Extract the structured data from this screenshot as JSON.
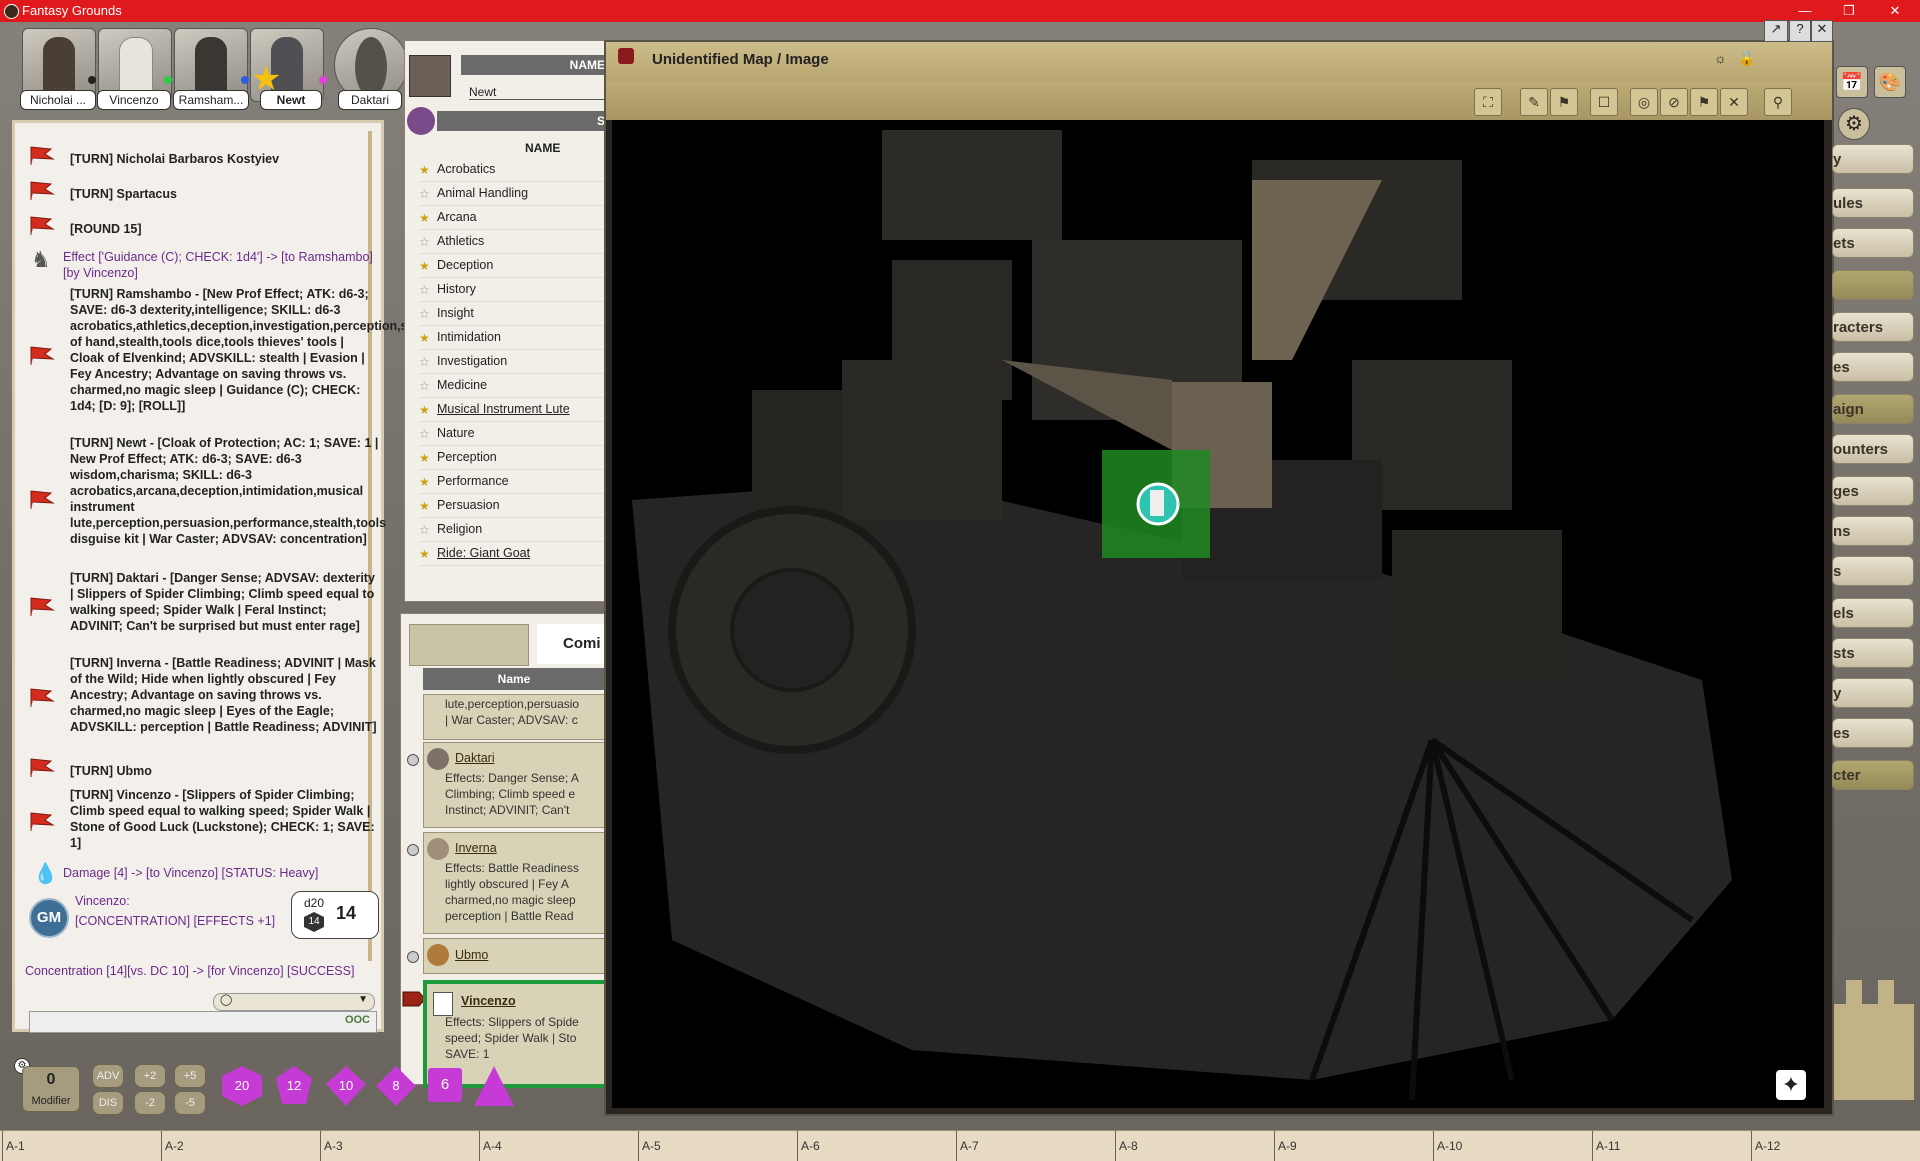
{
  "app": {
    "title": "Fantasy Grounds"
  },
  "portraits": [
    {
      "name": "Nicholai ...",
      "dot": "#222222"
    },
    {
      "name": "Vincenzo",
      "dot": "#2ecc40"
    },
    {
      "name": "Ramsham...",
      "dot": "#2b5ee0"
    },
    {
      "name": "Newt",
      "dot": "#e040e0"
    },
    {
      "name": "Daktari",
      "dot": ""
    }
  ],
  "chat": {
    "lines": [
      {
        "text": "[TURN] Nicholai Barbaros Kostyiev"
      },
      {
        "text": "[TURN] Spartacus"
      },
      {
        "text": "[ROUND 15]"
      },
      {
        "text": "Effect ['Guidance (C); CHECK: 1d4'] -> [to Ramshambo] [by Vincenzo]"
      },
      {
        "text": "[TURN] Ramshambo - [New Prof Effect; ATK: d6-3; SAVE: d6-3 dexterity,intelligence; SKILL: d6-3 acrobatics,athletics,deception,investigation,perception,sleight of hand,stealth,tools dice,tools thieves' tools | Cloak of Elvenkind; ADVSKILL: stealth | Evasion | Fey Ancestry; Advantage on saving throws vs. charmed,no magic sleep | Guidance (C); CHECK: 1d4; [D: 9]; [ROLL]]"
      },
      {
        "text": "[TURN] Newt - [Cloak of Protection; AC: 1; SAVE: 1 | New Prof Effect; ATK: d6-3; SAVE: d6-3 wisdom,charisma; SKILL: d6-3 acrobatics,arcana,deception,intimidation,musical instrument lute,perception,persuasion,performance,stealth,tools disguise kit | War Caster; ADVSAV: concentration]"
      },
      {
        "text": "[TURN] Daktari - [Danger Sense; ADVSAV: dexterity | Slippers of Spider Climbing; Climb speed equal to walking speed; Spider Walk | Feral Instinct; ADVINIT; Can't be surprised but must enter rage]"
      },
      {
        "text": "[TURN] Inverna - [Battle Readiness; ADVINIT | Mask of the Wild; Hide when lightly obscured | Fey Ancestry; Advantage on saving throws vs. charmed,no magic sleep | Eyes of the Eagle; ADVSKILL: perception | Battle Readiness; ADVINIT]"
      },
      {
        "text": "[TURN] Ubmo"
      },
      {
        "text": "[TURN] Vincenzo - [Slippers of Spider Climbing; Climb speed equal to walking speed; Spider Walk | Stone of Good Luck (Luckstone); CHECK: 1; SAVE: 1]"
      },
      {
        "text": "Damage [4] -> [to Vincenzo] [STATUS: Heavy]"
      },
      {
        "text": "Vincenzo:"
      },
      {
        "text": "[CONCENTRATION] [EFFECTS +1]"
      },
      {
        "text": "Concentration [14][vs. DC 10] -> [for Vincenzo] [SUCCESS]"
      }
    ],
    "gm_badge": "GM",
    "dice_result": {
      "die": "d20",
      "face": "14",
      "total": "14"
    },
    "ooc": "OOC"
  },
  "sheet": {
    "name_header": "NAME",
    "char_name": "Newt",
    "skills_header": "NAME",
    "skills_tab": "S",
    "skills": [
      {
        "name": "Acrobatics",
        "prof": true
      },
      {
        "name": "Animal Handling",
        "prof": false
      },
      {
        "name": "Arcana",
        "prof": true
      },
      {
        "name": "Athletics",
        "prof": false
      },
      {
        "name": "Deception",
        "prof": true
      },
      {
        "name": "History",
        "prof": false
      },
      {
        "name": "Insight",
        "prof": false
      },
      {
        "name": "Intimidation",
        "prof": true
      },
      {
        "name": "Investigation",
        "prof": false
      },
      {
        "name": "Medicine",
        "prof": false
      },
      {
        "name": "Musical Instrument Lute",
        "prof": true
      },
      {
        "name": "Nature",
        "prof": false
      },
      {
        "name": "Perception",
        "prof": true
      },
      {
        "name": "Performance",
        "prof": true
      },
      {
        "name": "Persuasion",
        "prof": true
      },
      {
        "name": "Religion",
        "prof": false
      },
      {
        "name": "Ride: Giant Goat",
        "prof": true
      }
    ]
  },
  "combat": {
    "title": "Comi",
    "col_name": "Name",
    "top_effects": [
      "lute,perception,persuasio",
      "| War Caster; ADVSAV: c"
    ],
    "entries": [
      {
        "name": "Daktari",
        "effects": [
          "Effects: Danger Sense; A",
          "Climbing; Climb speed e",
          "Instinct; ADVINIT; Can't"
        ]
      },
      {
        "name": "Inverna",
        "effects": [
          "Effects: Battle Readiness",
          "lightly obscured | Fey A",
          "charmed,no magic sleep",
          "perception | Battle Read"
        ]
      },
      {
        "name": "Ubmo",
        "effects": []
      },
      {
        "name": "Vincenzo",
        "effects": [
          "Effects: Slippers of Spide",
          "speed; Spider Walk | Sto",
          "SAVE: 1"
        ]
      }
    ]
  },
  "map": {
    "title": "Unidentified Map / Image"
  },
  "sidebar": {
    "buttons": [
      "y",
      "ules",
      "ets",
      "",
      "racters",
      "es",
      "aign",
      "ounters",
      "ges",
      "ns",
      "s",
      "els",
      "sts",
      "y",
      "es",
      "cter"
    ]
  },
  "dicetray": {
    "modifier_value": "0",
    "modifier_label": "Modifier",
    "adv": "ADV",
    "dis": "DIS",
    "p2": "+2",
    "p5": "+5",
    "m2": "-2",
    "m5": "-5",
    "dice": [
      "20",
      "12",
      "10",
      "8",
      "6",
      ""
    ]
  },
  "ruler": [
    "A-1",
    "A-2",
    "A-3",
    "A-4",
    "A-5",
    "A-6",
    "A-7",
    "A-8",
    "A-9",
    "A-10",
    "A-11",
    "A-12"
  ]
}
